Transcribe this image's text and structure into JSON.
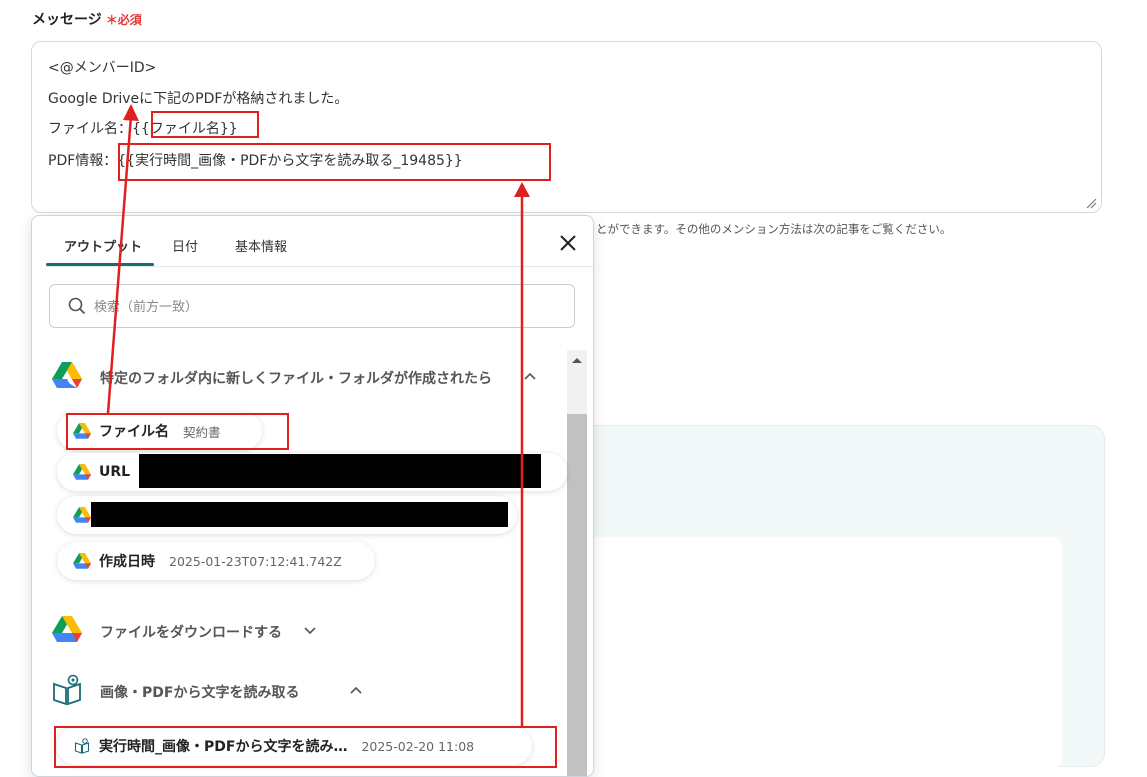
{
  "field": {
    "label": "メッセージ",
    "required_mark": "＊必須"
  },
  "message": {
    "line1": "<@メンバーID>",
    "line2": "Google Driveに下記のPDFが格納されました。",
    "line3": "ファイル名：{{ファイル名}}",
    "line4": "PDF情報：{{実行時間_画像・PDFから文字を読み取る_19485}}"
  },
  "helper_text": "とができます。その他のメンション方法は次の記事をご覧ください。",
  "popup": {
    "tabs": [
      "アウトプット",
      "日付",
      "基本情報"
    ],
    "search_placeholder": "検索（前方一致）",
    "sections": [
      {
        "title": "特定のフォルダ内に新しくファイル・フォルダが作成されたら",
        "icon": "google-drive-icon",
        "expanded": true,
        "items": [
          {
            "name": "ファイル名",
            "value": "契約書"
          },
          {
            "name": "URL",
            "value": ""
          },
          {
            "name": "",
            "value": ""
          },
          {
            "name": "作成日時",
            "value": "2025-01-23T07:12:41.742Z"
          }
        ]
      },
      {
        "title": "ファイルをダウンロードする",
        "icon": "google-drive-icon",
        "expanded": false,
        "items": []
      },
      {
        "title": "画像・PDFから文字を読み取る",
        "icon": "ocr-book-icon",
        "expanded": true,
        "items": [
          {
            "name": "実行時間_画像・PDFから文字を読み…",
            "value": "2025-02-20 11:08"
          }
        ]
      }
    ]
  },
  "colors": {
    "accent": "#1a6b78",
    "required": "#e53935",
    "annotation": "#e02020",
    "panel_bg": "#f3f9f9"
  }
}
